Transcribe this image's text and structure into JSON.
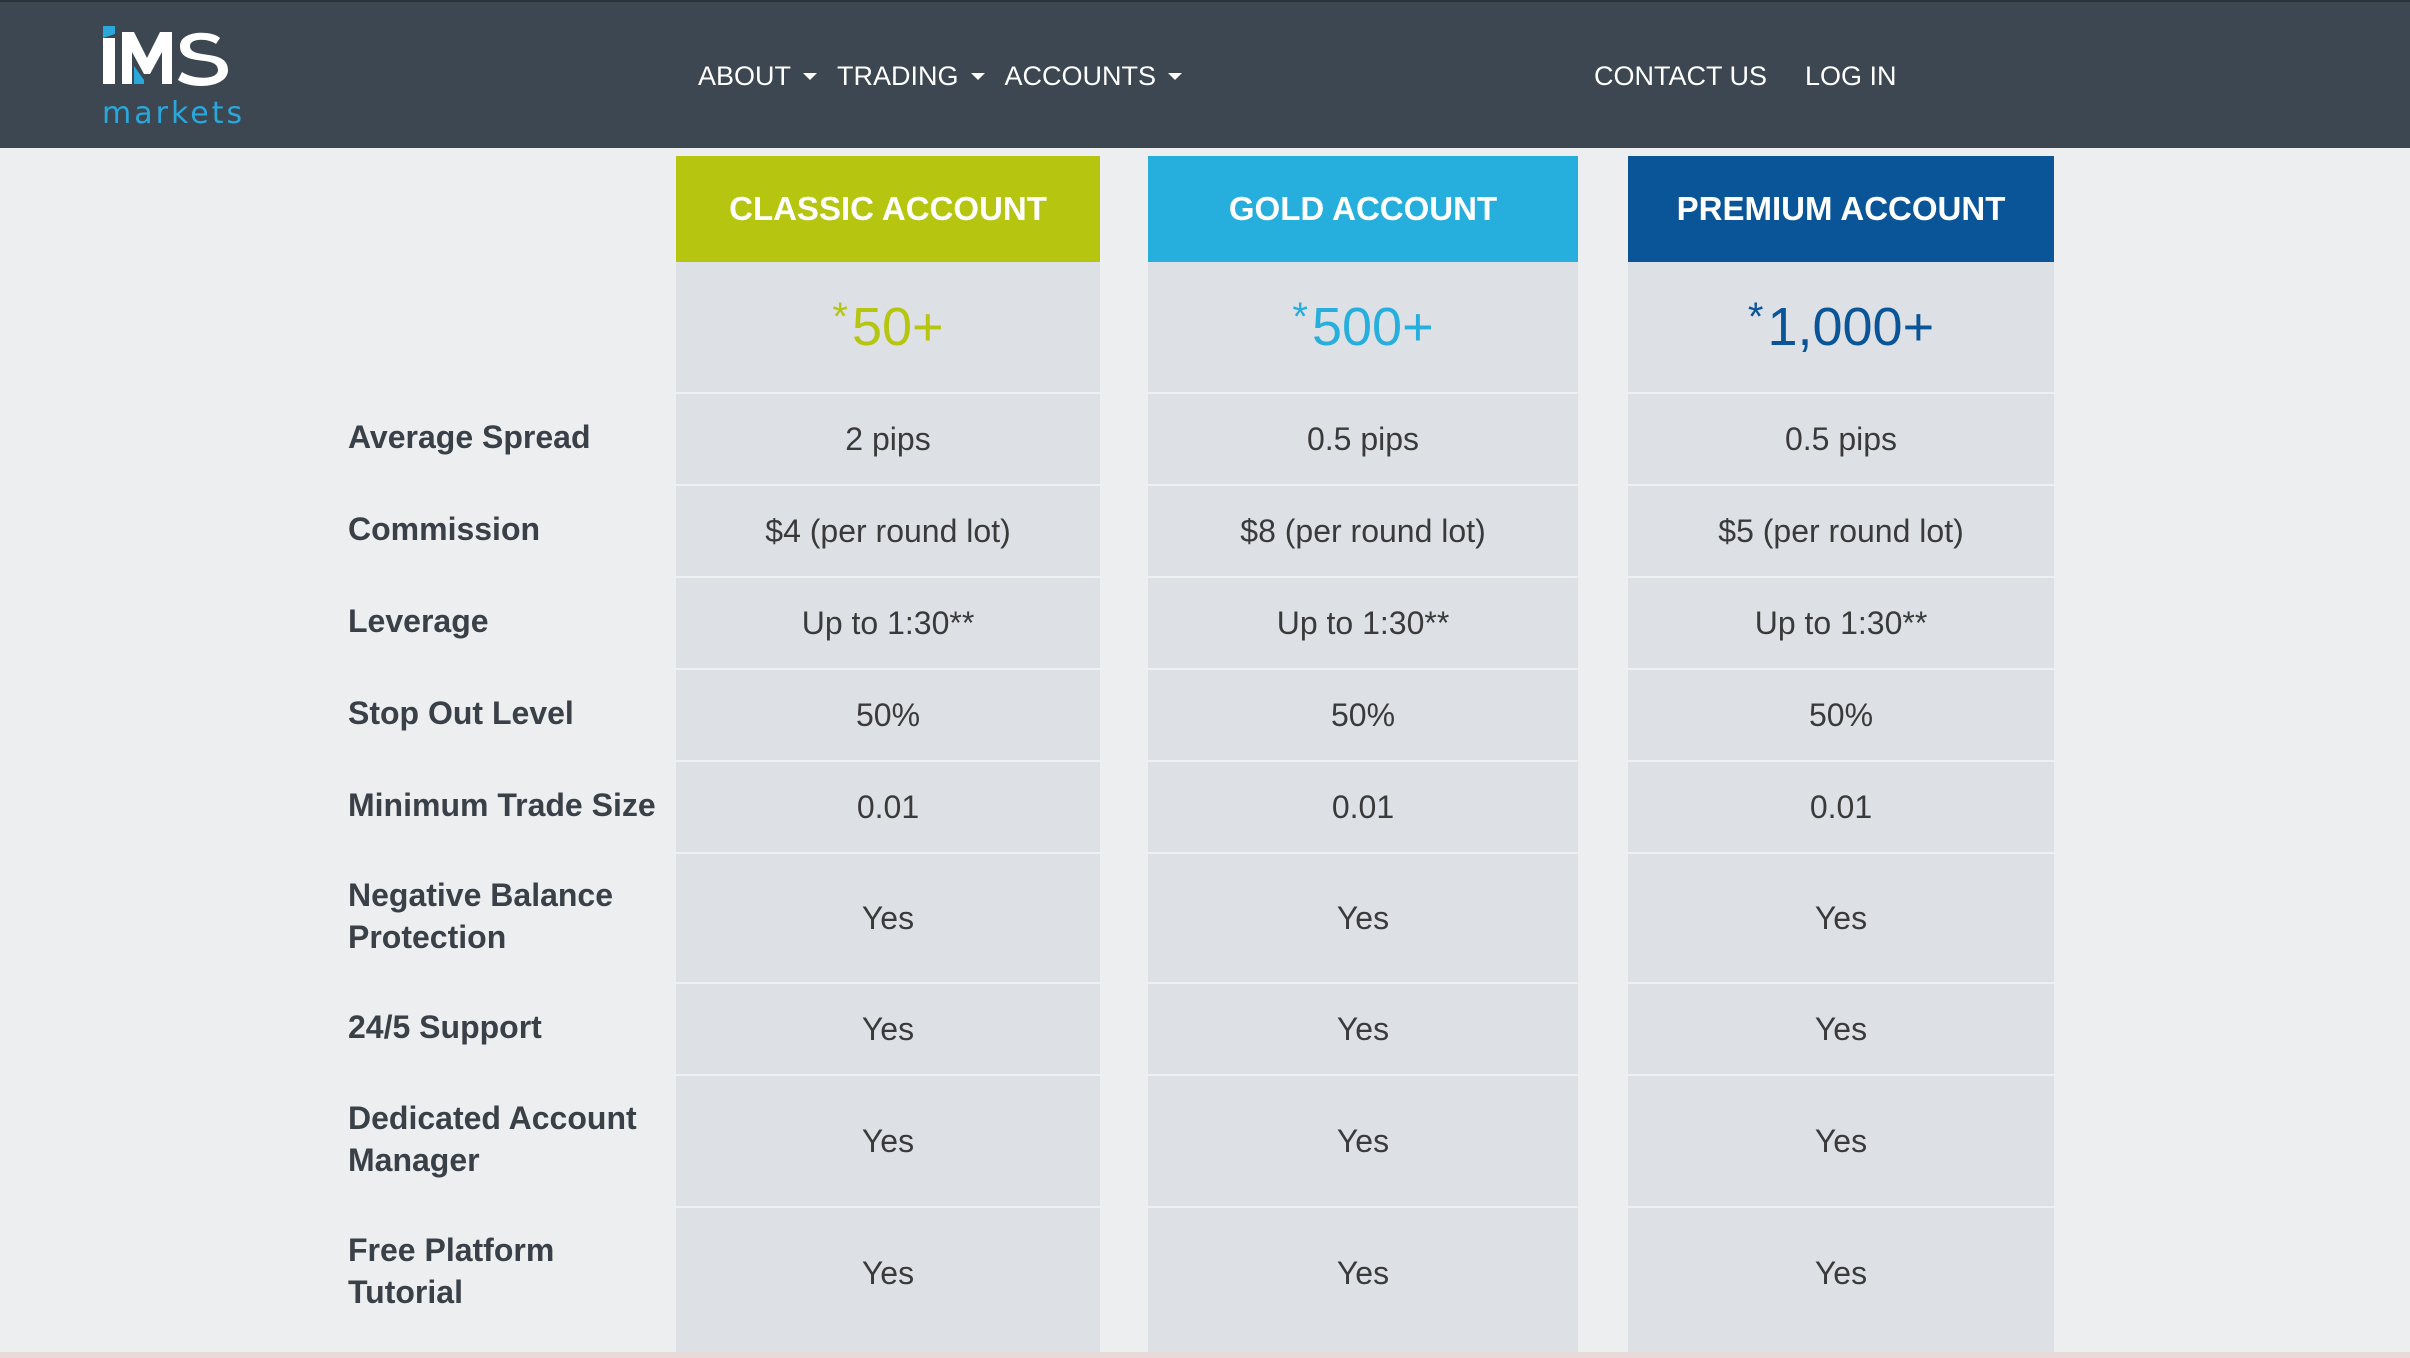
{
  "header": {
    "logo_text": "IMS",
    "logo_sub": "markets",
    "nav_left": [
      {
        "label": "ABOUT",
        "dropdown": true
      },
      {
        "label": "TRADING",
        "dropdown": true
      },
      {
        "label": "ACCOUNTS",
        "dropdown": true
      }
    ],
    "nav_right": [
      {
        "label": "CONTACT US"
      },
      {
        "label": "LOG IN"
      }
    ]
  },
  "colors": {
    "topbar": "#3c4751",
    "classic": "#b5c510",
    "gold": "#26aedc",
    "premium": "#0a5598",
    "cell_bg": "#dde1e5",
    "page_bg": "#eceef0"
  },
  "rows": [
    "Average Spread",
    "Commission",
    "Leverage",
    "Stop Out Level",
    "Minimum Trade Size",
    "Negative Balance Protection",
    "24/5 Support",
    "Dedicated Account Manager",
    "Free Platform Tutorial"
  ],
  "accounts": [
    {
      "name": "CLASSIC ACCOUNT",
      "price_star": "*",
      "price": "50+",
      "values": [
        "2 pips",
        "$4 (per round lot)",
        "Up to 1:30**",
        "50%",
        "0.01",
        "Yes",
        "Yes",
        "Yes",
        "Yes"
      ]
    },
    {
      "name": "GOLD ACCOUNT",
      "price_star": "*",
      "price": "500+",
      "values": [
        "0.5 pips",
        "$8 (per round lot)",
        "Up to 1:30**",
        "50%",
        "0.01",
        "Yes",
        "Yes",
        "Yes",
        "Yes"
      ]
    },
    {
      "name": "PREMIUM ACCOUNT",
      "price_star": "*",
      "price": "1,000+",
      "values": [
        "0.5 pips",
        "$5 (per round lot)",
        "Up to 1:30**",
        "50%",
        "0.01",
        "Yes",
        "Yes",
        "Yes",
        "Yes"
      ]
    }
  ]
}
